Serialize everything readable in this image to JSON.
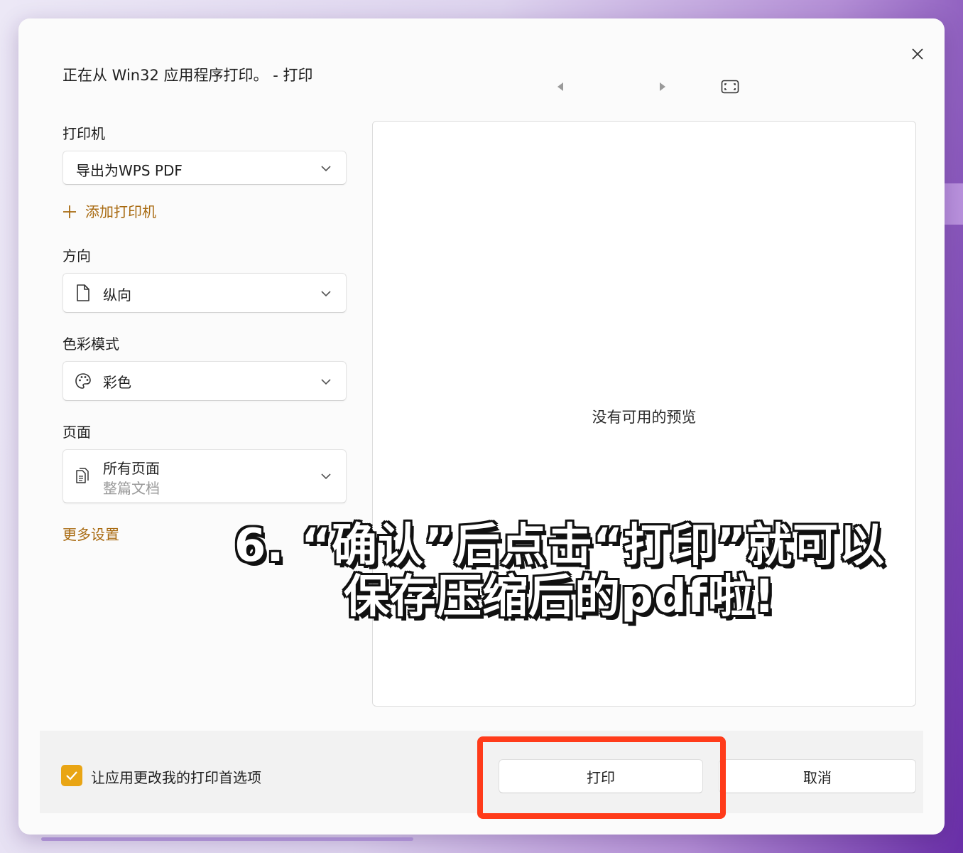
{
  "dialog": {
    "title": "正在从 Win32 应用程序打印。 - 打印",
    "close_icon": "close-icon"
  },
  "preview_nav": {
    "prev_icon": "triangle-left-icon",
    "next_icon": "triangle-right-icon",
    "fit_icon": "fit-screen-icon"
  },
  "printer": {
    "label": "打印机",
    "value": "导出为WPS PDF",
    "add_label": "添加打印机"
  },
  "orientation": {
    "label": "方向",
    "value": "纵向",
    "icon": "page-icon"
  },
  "color_mode": {
    "label": "色彩模式",
    "value": "彩色",
    "icon": "palette-icon"
  },
  "pages": {
    "label": "页面",
    "value": "所有页面",
    "sub": "整篇文档",
    "icon": "pages-icon"
  },
  "more_settings": "更多设置",
  "preview": {
    "message": "没有可用的预览"
  },
  "footer": {
    "checkbox_label": "让应用更改我的打印首选项",
    "checkbox_checked": true,
    "print_label": "打印",
    "cancel_label": "取消"
  },
  "overlay_caption": {
    "line1": "6. “确认”后点击“打印”就可以",
    "line2": "保存压缩后的pdf啦!"
  },
  "colors": {
    "accent": "#e9a514",
    "link": "#a86a10",
    "highlight": "#ff3b1a"
  }
}
